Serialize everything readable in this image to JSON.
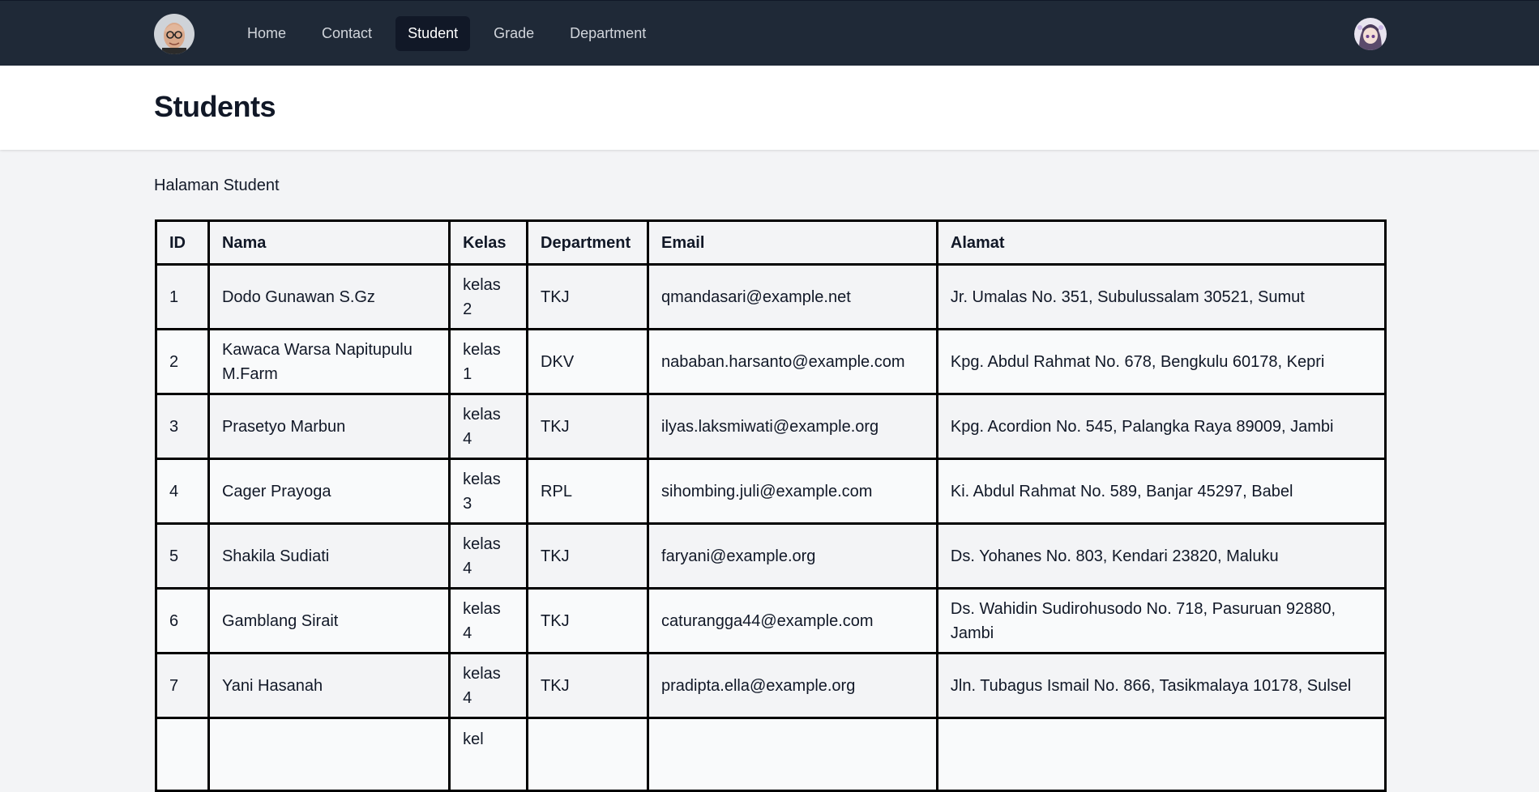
{
  "nav": {
    "links": [
      {
        "label": "Home",
        "active": false
      },
      {
        "label": "Contact",
        "active": false
      },
      {
        "label": "Student",
        "active": true
      },
      {
        "label": "Grade",
        "active": false
      },
      {
        "label": "Department",
        "active": false
      }
    ]
  },
  "header": {
    "title": "Students"
  },
  "main": {
    "intro": "Halaman Student",
    "table": {
      "columns": [
        "ID",
        "Nama",
        "Kelas",
        "Department",
        "Email",
        "Alamat"
      ],
      "rows": [
        {
          "id": "1",
          "nama": "Dodo Gunawan S.Gz",
          "kelas": "kelas 2",
          "department": "TKJ",
          "email": "qmandasari@example.net",
          "alamat": "Jr. Umalas No. 351, Subulussalam 30521, Sumut"
        },
        {
          "id": "2",
          "nama": "Kawaca Warsa Napitupulu M.Farm",
          "kelas": "kelas 1",
          "department": "DKV",
          "email": "nababan.harsanto@example.com",
          "alamat": "Kpg. Abdul Rahmat No. 678, Bengkulu 60178, Kepri"
        },
        {
          "id": "3",
          "nama": "Prasetyo Marbun",
          "kelas": "kelas 4",
          "department": "TKJ",
          "email": "ilyas.laksmiwati@example.org",
          "alamat": "Kpg. Acordion No. 545, Palangka Raya 89009, Jambi"
        },
        {
          "id": "4",
          "nama": "Cager Prayoga",
          "kelas": "kelas 3",
          "department": "RPL",
          "email": "sihombing.juli@example.com",
          "alamat": "Ki. Abdul Rahmat No. 589, Banjar 45297, Babel"
        },
        {
          "id": "5",
          "nama": "Shakila Sudiati",
          "kelas": "kelas 4",
          "department": "TKJ",
          "email": "faryani@example.org",
          "alamat": "Ds. Yohanes No. 803, Kendari 23820, Maluku"
        },
        {
          "id": "6",
          "nama": "Gamblang Sirait",
          "kelas": "kelas 4",
          "department": "TKJ",
          "email": "caturangga44@example.com",
          "alamat": "Ds. Wahidin Sudirohusodo No. 718, Pasuruan 92880, Jambi"
        },
        {
          "id": "7",
          "nama": "Yani Hasanah",
          "kelas": "kelas 4",
          "department": "TKJ",
          "email": "pradipta.ella@example.org",
          "alamat": "Jln. Tubagus Ismail No. 866, Tasikmalaya 10178, Sulsel"
        },
        {
          "id": "",
          "nama": "",
          "kelas": "kel",
          "department": "",
          "email": "",
          "alamat": ""
        }
      ]
    }
  }
}
